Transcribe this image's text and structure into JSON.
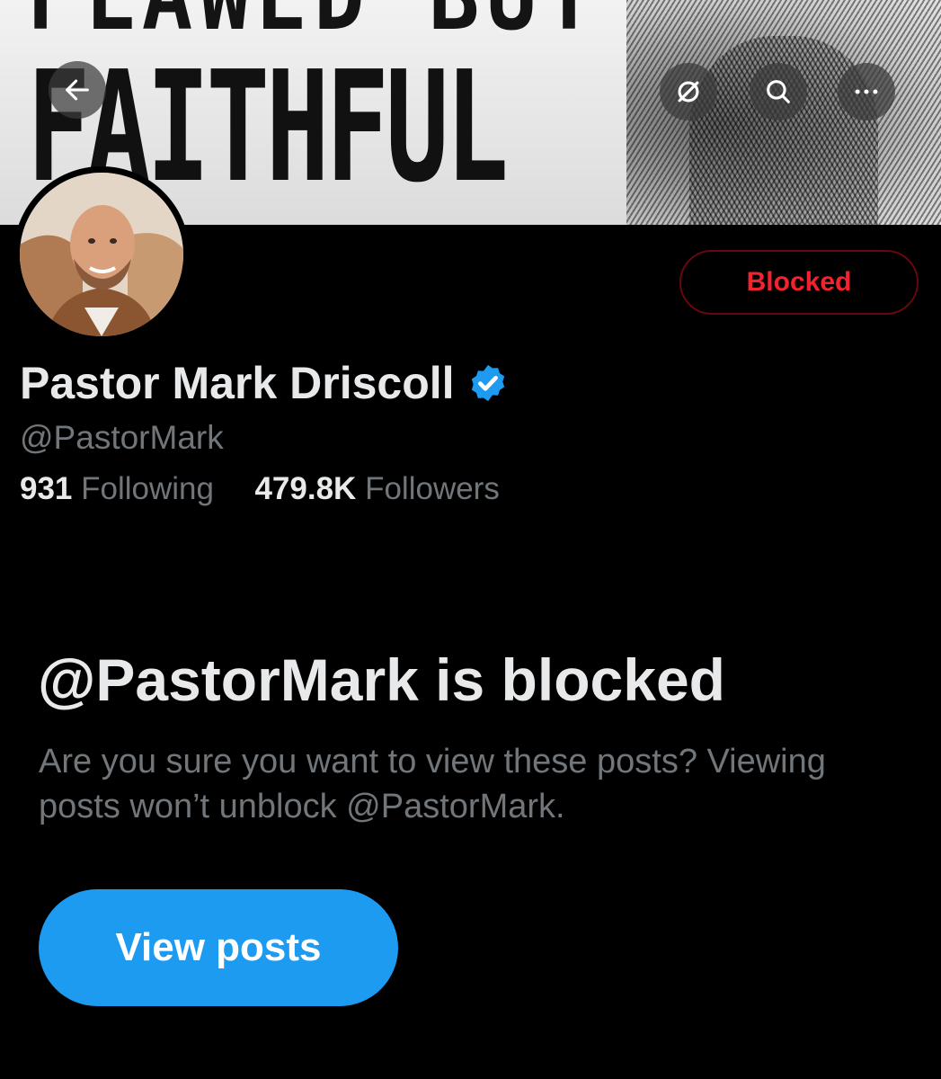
{
  "banner": {
    "line1": "FLAWED BUT",
    "line2": "FAITHFUL"
  },
  "toolbar": {
    "back_icon": "arrow-left-icon",
    "grok_icon": "slashed-circle-icon",
    "search_icon": "search-icon",
    "more_icon": "more-horizontal-icon"
  },
  "profile": {
    "display_name": "Pastor Mark Driscoll",
    "handle": "@PastorMark",
    "following_count": "931",
    "following_label": "Following",
    "followers_count": "479.8K",
    "followers_label": "Followers",
    "verified_icon": "verified-badge-icon"
  },
  "blocked_button": {
    "label": "Blocked"
  },
  "blocked_notice": {
    "title": "@PastorMark is blocked",
    "description": "Are you sure you want to view these posts? Viewing posts won’t unblock @PastorMark.",
    "button_label": "View posts"
  },
  "colors": {
    "background": "#000000",
    "accent_blue": "#1d9bf0",
    "blocked_red": "#f4212e",
    "secondary_text": "#71767b",
    "primary_text": "#e7e9ea"
  }
}
